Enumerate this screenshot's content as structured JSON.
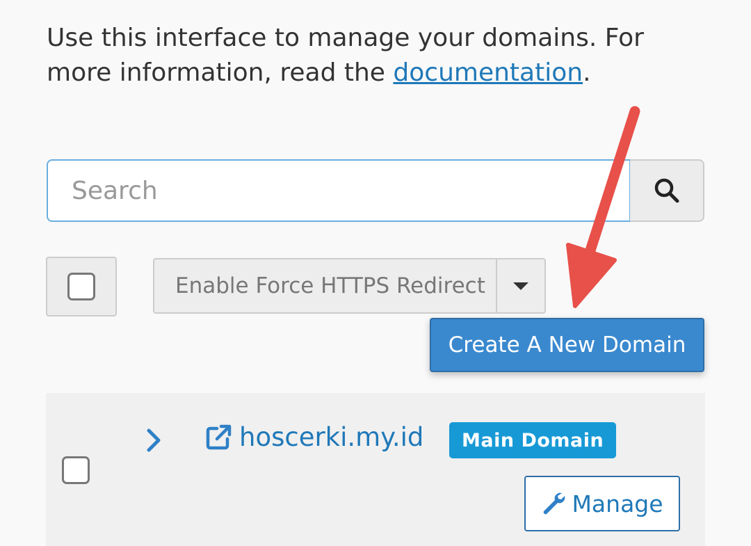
{
  "intro": {
    "text_before": "Use this interface to manage your domains. For more information, read the ",
    "link_text": "documentation",
    "text_after": "."
  },
  "search": {
    "placeholder": "Search",
    "button_icon": "search-icon"
  },
  "bulk": {
    "action_label": "Enable Force HTTPS Redirect"
  },
  "create_button_label": "Create A New Domain",
  "domains": [
    {
      "name": "hoscerki.my.id",
      "badge": "Main Domain",
      "manage_label": "Manage"
    }
  ],
  "colors": {
    "link": "#1f78b8",
    "primary_button": "#3a89cf",
    "badge": "#1799d6",
    "annotation_arrow": "#e8504a"
  }
}
